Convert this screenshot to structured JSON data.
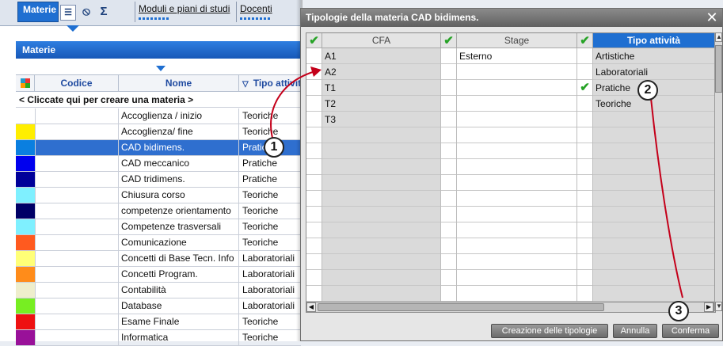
{
  "tabs": {
    "materie": "Materie",
    "moduli": "Moduli e piani di studi",
    "docenti": "Docenti",
    "sigma": "Σ",
    "forbidden": "⃠"
  },
  "section": {
    "title": "Materie"
  },
  "columns": {
    "codice": "Codice",
    "nome": "Nome",
    "tipo": "Tipo attività"
  },
  "create_row": "< Cliccate qui per creare una materia >",
  "materie": [
    {
      "color": "#ffffff",
      "nome": "Accoglienza / inizio",
      "tipo": "Teoriche"
    },
    {
      "color": "#ffee00",
      "nome": "Accoglienza/ fine",
      "tipo": "Teoriche"
    },
    {
      "color": "#0a7fe0",
      "nome": "CAD bidimens.",
      "tipo": "Pratiche",
      "selected": true
    },
    {
      "color": "#0000ee",
      "nome": "CAD meccanico",
      "tipo": "Pratiche"
    },
    {
      "color": "#000099",
      "nome": "CAD tridimens.",
      "tipo": "Pratiche"
    },
    {
      "color": "#7ff0ff",
      "nome": "Chiusura corso",
      "tipo": "Teoriche"
    },
    {
      "color": "#000066",
      "nome": "competenze orientamento",
      "tipo": "Teoriche"
    },
    {
      "color": "#7ff0ff",
      "nome": "Competenze trasversali",
      "tipo": "Teoriche"
    },
    {
      "color": "#ff5a1f",
      "nome": "Comunicazione",
      "tipo": "Teoriche"
    },
    {
      "color": "#ffff77",
      "nome": "Concetti di Base Tecn. Info",
      "tipo": "Laboratoriali"
    },
    {
      "color": "#ff8c1a",
      "nome": "Concetti Program.",
      "tipo": "Laboratoriali"
    },
    {
      "color": "#eeeecc",
      "nome": "Contabilità",
      "tipo": "Laboratoriali"
    },
    {
      "color": "#77ee22",
      "nome": "Database",
      "tipo": "Laboratoriali"
    },
    {
      "color": "#ee1111",
      "nome": "Esame Finale",
      "tipo": "Teoriche"
    },
    {
      "color": "#991199",
      "nome": "Informatica",
      "tipo": "Teoriche"
    }
  ],
  "dialog": {
    "title": "Tipologie della materia CAD bidimens.",
    "close": "✕",
    "headers": {
      "cfa": "CFA",
      "stage": "Stage",
      "tipo": "Tipo attività"
    },
    "checkmark": "✔",
    "cfa": [
      "A1",
      "A2",
      "T1",
      "T2",
      "T3"
    ],
    "stage": [
      "Esterno"
    ],
    "tipo": [
      "Artistiche",
      "Laboratoriali",
      "Pratiche",
      "Teoriche"
    ],
    "tipo_checked_index": 2,
    "buttons": {
      "creazione": "Creazione delle tipologie",
      "annulla": "Annulla",
      "conferma": "Conferma"
    }
  },
  "callouts": [
    "1",
    "2",
    "3"
  ],
  "colors": {
    "accent": "#1f6fd1",
    "selected_row": "#2f6fcf",
    "check": "#27a327",
    "callout": "#c4001a"
  }
}
